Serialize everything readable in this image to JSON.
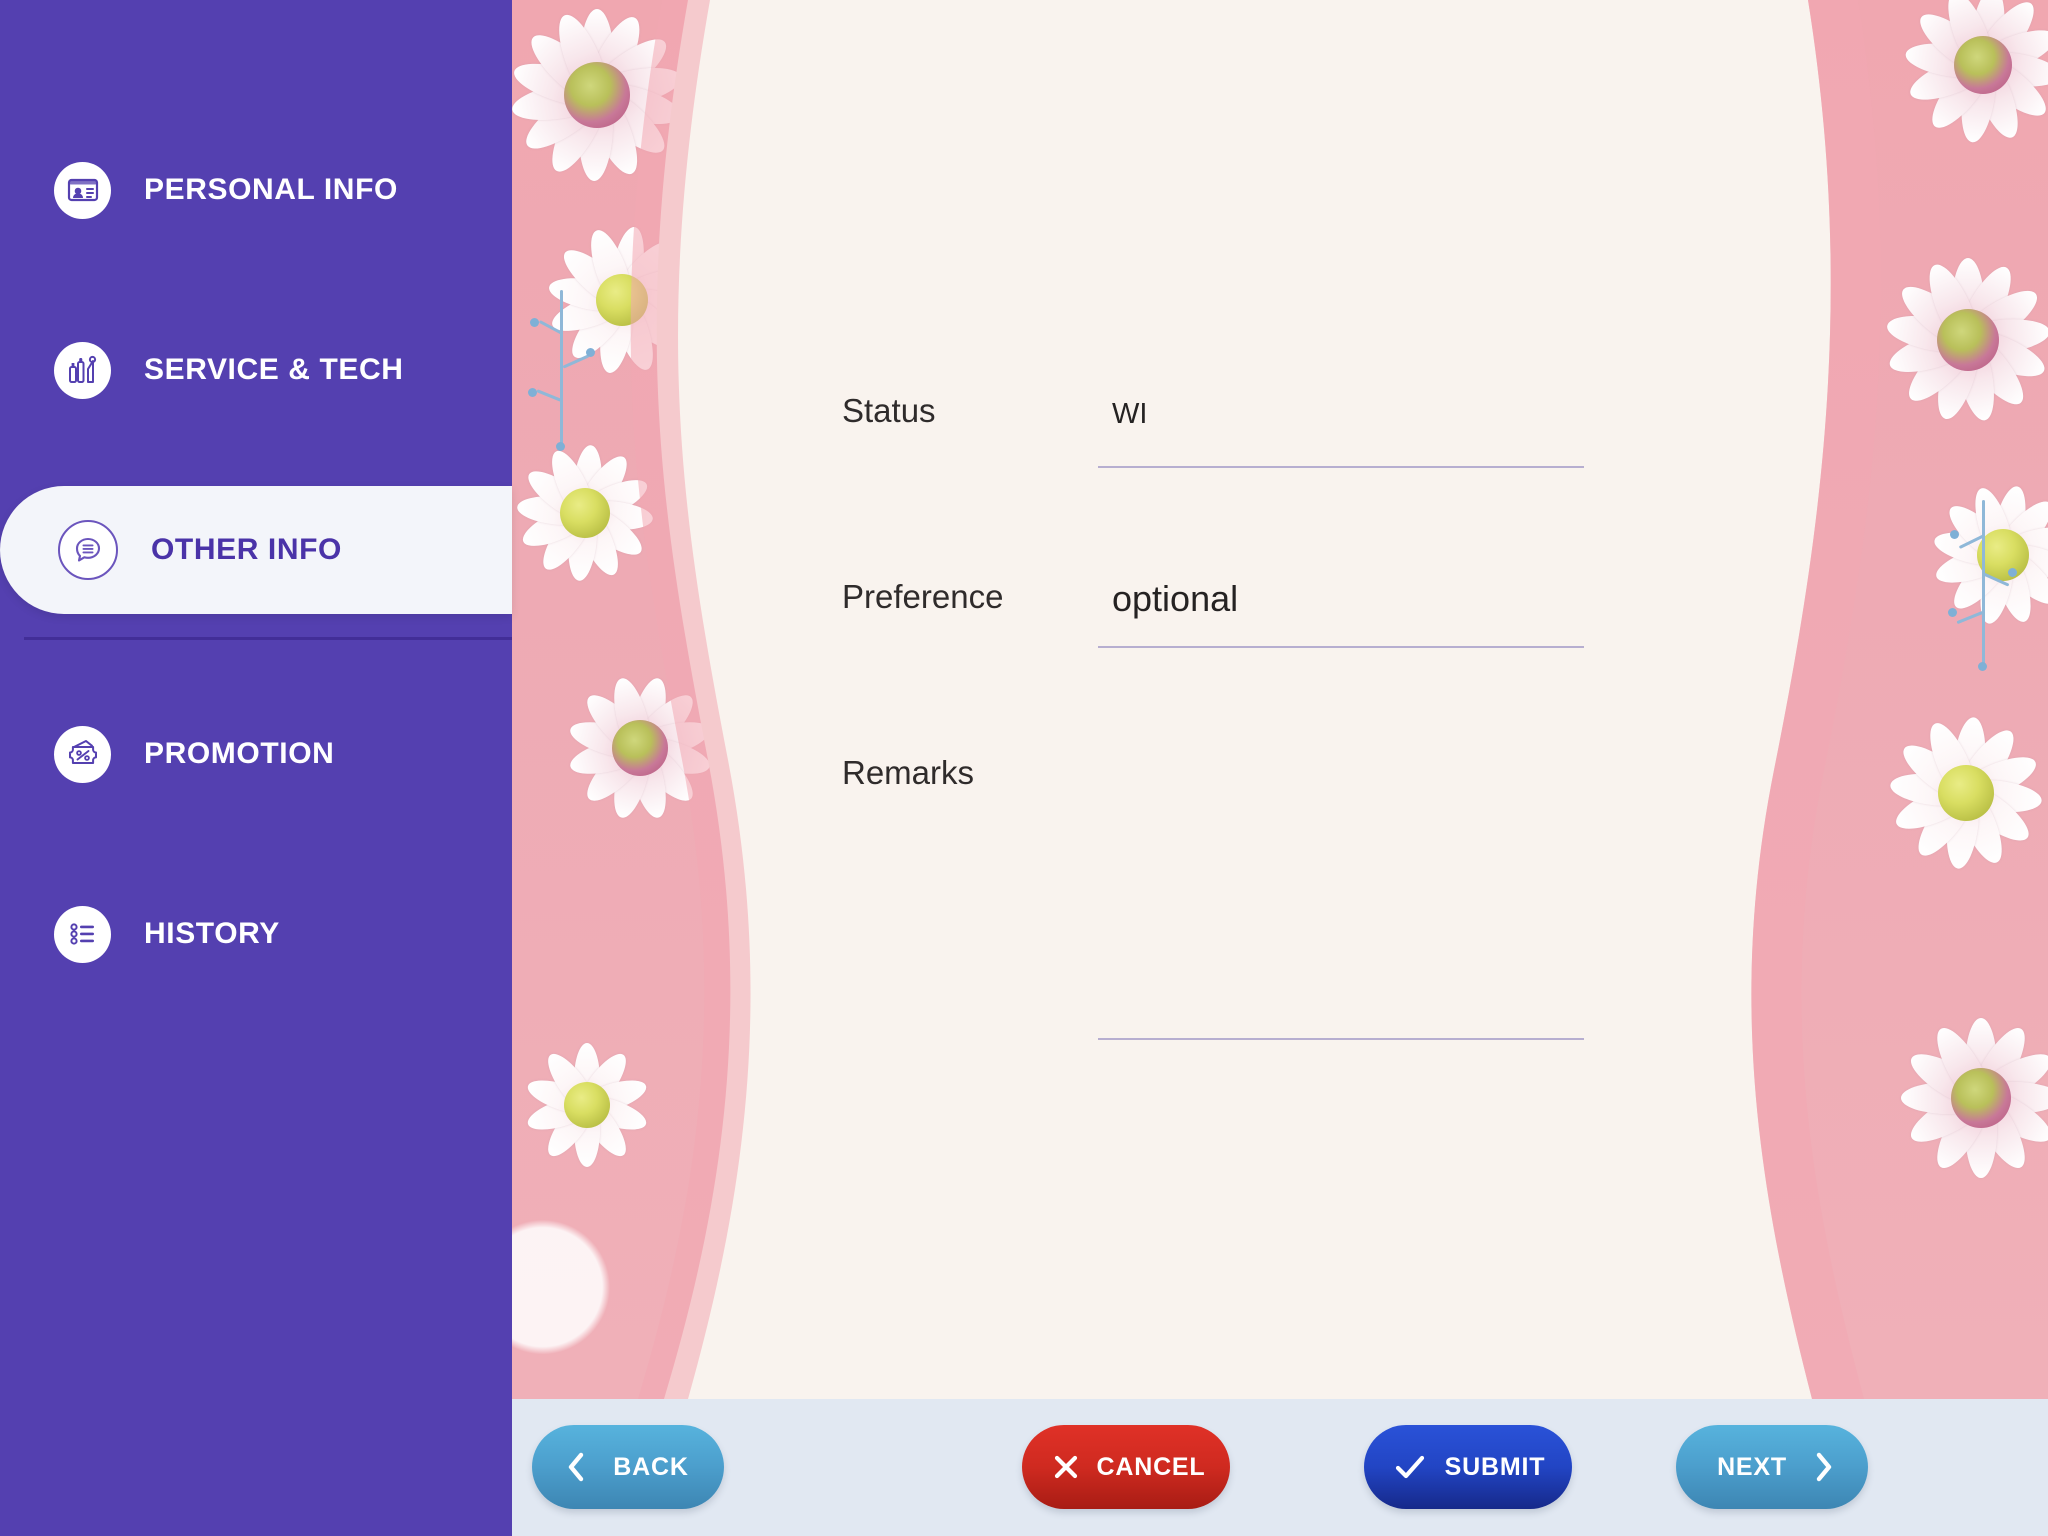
{
  "theme": {
    "sidebar_bg": "#5440b0",
    "sidebar_divider": "#3f2c93",
    "active_tab_bg": "#f3f5fa",
    "active_tab_text": "#4a33a8",
    "content_bg": "#f9f3ee",
    "footer_bg": "#e1e8f2",
    "field_underline": "#b7aed0",
    "accent_blue": "#4c9fcd",
    "accent_red": "#cf2a20",
    "accent_navy": "#2245c4"
  },
  "sidebar": {
    "items": [
      {
        "label": "PERSONAL INFO",
        "icon": "id-card-icon",
        "active": false
      },
      {
        "label": "SERVICE & TECH",
        "icon": "cosmetics-icon",
        "active": false
      },
      {
        "label": "OTHER INFO",
        "icon": "speech-bubble-icon",
        "active": true
      },
      {
        "label": "PROMOTION",
        "icon": "discount-ticket-icon",
        "active": false
      },
      {
        "label": "HISTORY",
        "icon": "list-icon",
        "active": false
      }
    ]
  },
  "form": {
    "fields": [
      {
        "name": "status",
        "label": "Status",
        "value": "WI",
        "placeholder": "",
        "type": "text",
        "size": "small"
      },
      {
        "name": "preference",
        "label": "Preference",
        "value": "optional",
        "placeholder": "optional",
        "type": "text",
        "size": "normal"
      },
      {
        "name": "remarks",
        "label": "Remarks",
        "value": "",
        "placeholder": "",
        "type": "textarea",
        "size": "normal"
      }
    ]
  },
  "footer": {
    "buttons": [
      {
        "name": "back",
        "label": "BACK",
        "icon": "chevron-left-icon",
        "color": "#4c9fcd"
      },
      {
        "name": "cancel",
        "label": "CANCEL",
        "icon": "close-x-icon",
        "color": "#cf2a20"
      },
      {
        "name": "submit",
        "label": "SUBMIT",
        "icon": "check-icon",
        "color": "#2245c4"
      },
      {
        "name": "next",
        "label": "NEXT",
        "icon": "chevron-right-icon",
        "color": "#4c9fcd"
      }
    ]
  }
}
